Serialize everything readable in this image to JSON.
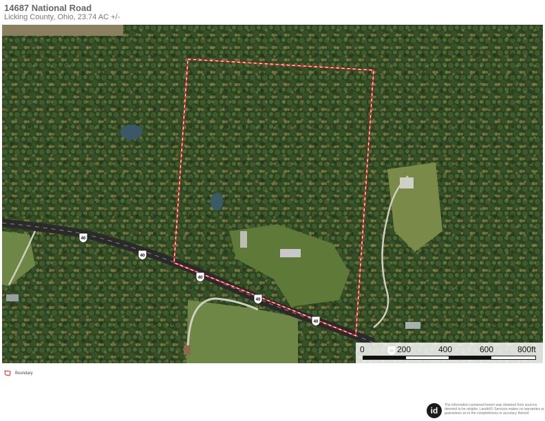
{
  "header": {
    "title": "14687 National Road",
    "subtitle": "Licking County, Ohio, 23.74 AC +/-"
  },
  "map": {
    "view": "satellite",
    "route_shields": [
      "40",
      "40",
      "40",
      "40",
      "40",
      "40"
    ],
    "boundary_color": "#e02222",
    "scale": {
      "labels": [
        "0",
        "200",
        "400",
        "600",
        "800ft"
      ]
    }
  },
  "legend": {
    "boundary_label": "Boundary",
    "icon": "boundary-polygon-icon"
  },
  "footer": {
    "logo_text": "id",
    "disclaimer": "The information contained herein was obtained from sources deemed to be reliable. LandidⓇ Services makes no warranties or guarantees as to the completeness or accuracy thereof."
  }
}
